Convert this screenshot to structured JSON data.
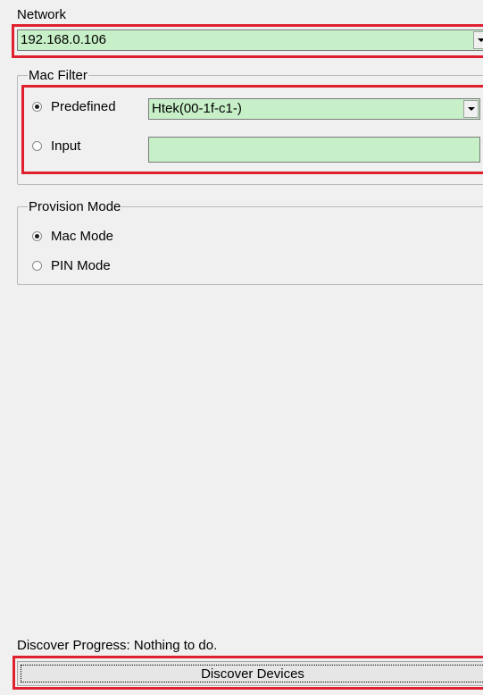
{
  "network": {
    "label": "Network",
    "value": "192.168.0.106"
  },
  "mac_filter": {
    "title": "Mac Filter",
    "options": [
      {
        "label": "Predefined",
        "selected": true
      },
      {
        "label": "Input",
        "selected": false
      }
    ],
    "predefined_value": "Htek(00-1f-c1-)",
    "input_value": ""
  },
  "provision_mode": {
    "title": "Provision Mode",
    "options": [
      {
        "label": "Mac Mode",
        "selected": true
      },
      {
        "label": "PIN Mode",
        "selected": false
      }
    ]
  },
  "progress": {
    "text": "Discover Progress: Nothing to do."
  },
  "actions": {
    "discover_label": "Discover Devices"
  },
  "colors": {
    "field_bg": "#c8f0c8",
    "highlight": "#e0202f",
    "window_bg": "#f0f0f0"
  }
}
